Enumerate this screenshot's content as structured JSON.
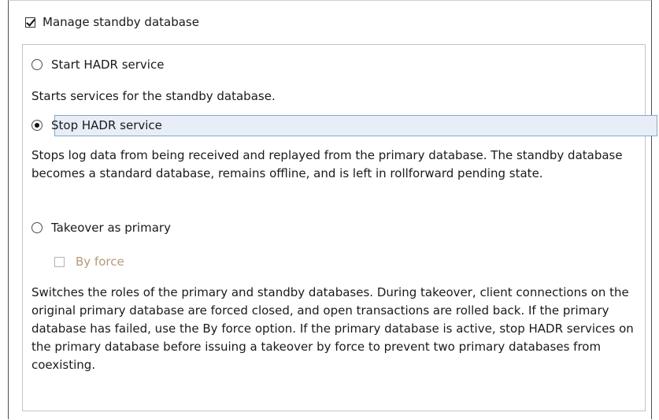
{
  "manage_standby": {
    "label": "Manage standby database",
    "checked": true
  },
  "options": {
    "start_hadr": {
      "label": "Start HADR service",
      "selected": false,
      "description": "Starts services for the standby database."
    },
    "stop_hadr": {
      "label": "Stop HADR service",
      "selected": true,
      "description": "Stops log data from being received and replayed from the primary database. The standby database becomes a standard database, remains offline, and is left in rollforward pending state."
    },
    "takeover": {
      "label": "Takeover as primary",
      "selected": false,
      "by_force": {
        "label": "By force",
        "checked": false,
        "enabled": false
      },
      "description": "Switches the roles of the primary and standby databases. During takeover, client connections on the original primary database are forced closed, and open transactions are rolled back. If the primary database has failed, use the By force option. If the primary database is active, stop HADR services on the primary database before issuing a takeover by force to prevent two primary databases from coexisting."
    }
  }
}
